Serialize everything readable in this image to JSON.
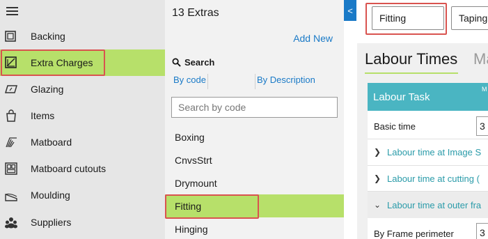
{
  "nav": {
    "items": [
      {
        "label": "Backing",
        "icon": "backing-icon"
      },
      {
        "label": "Extra Charges",
        "icon": "extra-charges-icon",
        "active": true
      },
      {
        "label": "Glazing",
        "icon": "glazing-icon"
      },
      {
        "label": "Items",
        "icon": "items-icon"
      },
      {
        "label": "Matboard",
        "icon": "matboard-icon"
      },
      {
        "label": "Matboard cutouts",
        "icon": "matboard-cutouts-icon"
      },
      {
        "label": "Moulding",
        "icon": "moulding-icon"
      },
      {
        "label": "Suppliers",
        "icon": "suppliers-icon"
      }
    ]
  },
  "list": {
    "title": "13 Extras",
    "add_new": "Add New",
    "search_label": "Search",
    "tab_code": "By code",
    "tab_description": "By Description",
    "search_placeholder": "Search by code",
    "items": [
      "Boxing",
      "CnvsStrt",
      "Drymount",
      "Fitting",
      "Hinging"
    ],
    "selected": "Fitting"
  },
  "detail": {
    "collapse_glyph": "<",
    "chips": [
      "Fitting",
      "Taping"
    ],
    "tabs": [
      "Labour Times",
      "Ma"
    ],
    "section_header": "Labour Task",
    "section_header_right": "M",
    "basic_time_label": "Basic time",
    "basic_time_value": "3",
    "expanders": [
      {
        "label": "Labour time at Image S",
        "open": false
      },
      {
        "label": "Labour time at cutting (",
        "open": false
      },
      {
        "label": "Labour time at outer fra",
        "open": true
      }
    ],
    "frame_perimeter_label": "By Frame perimeter",
    "frame_perimeter_value": "3"
  },
  "colors": {
    "accent_green": "#b7e06a",
    "link_blue": "#1a7ac7",
    "teal": "#4ab5c2",
    "highlight_red": "#d9534f"
  }
}
